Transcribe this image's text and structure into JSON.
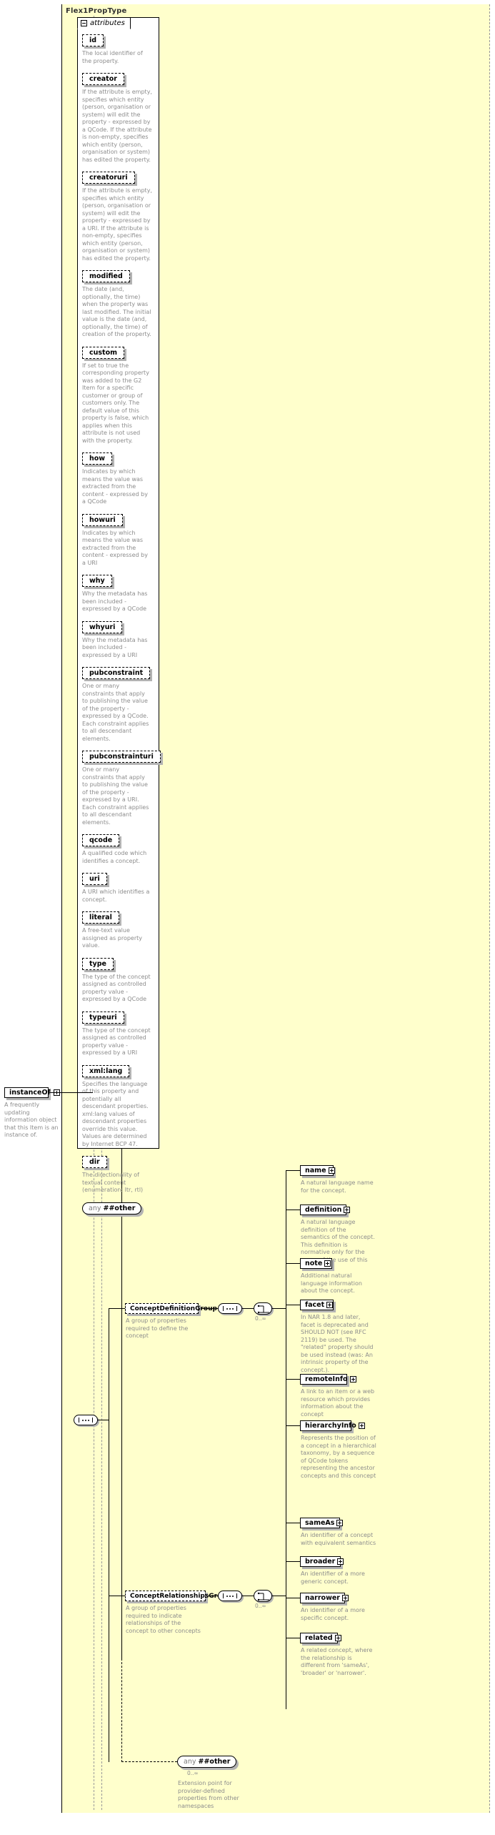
{
  "diagram": {
    "type_name": "Flex1PropType",
    "attributes_tab_label": "attributes",
    "colors": {
      "panel_fill": "#ffffcc",
      "box_fill": "#ffffff",
      "line": "#000000",
      "doc_text": "#8c8c8c",
      "shadow": "#b3b3b3"
    }
  },
  "attributes": [
    {
      "name": "id",
      "doc": "The local identifier of the property."
    },
    {
      "name": "creator",
      "doc": "If the attribute is empty, specifies which entity (person, organisation or system) will edit the property - expressed by a QCode. If the attribute is non-empty, specifies which entity (person, organisation or system) has edited the property."
    },
    {
      "name": "creatoruri",
      "doc": "If the attribute is empty, specifies which entity (person, organisation or system) will edit the property - expressed by a URI. If the attribute is non-empty, specifies which entity (person, organisation or system) has edited the property."
    },
    {
      "name": "modified",
      "doc": "The date (and, optionally, the time) when the property was last modified. The initial value is the date (and, optionally, the time) of creation of the property."
    },
    {
      "name": "custom",
      "doc": "If set to true the corresponding property was added to the G2 Item for a specific customer or group of customers only. The default value of this property is false, which applies when this attribute is not used with the property."
    },
    {
      "name": "how",
      "doc": "Indicates by which means the value was extracted from the content - expressed by a QCode"
    },
    {
      "name": "howuri",
      "doc": "Indicates by which means the value was extracted from the content - expressed by a URI"
    },
    {
      "name": "why",
      "doc": "Why the metadata has been included - expressed by a QCode"
    },
    {
      "name": "whyuri",
      "doc": "Why the metadata has been included - expressed by a URI"
    },
    {
      "name": "pubconstraint",
      "doc": "One or many constraints that apply to publishing the value of the property - expressed by a QCode. Each constraint applies to all descendant elements."
    },
    {
      "name": "pubconstrainturi",
      "doc": "One or many constraints that apply to publishing the value of the property - expressed by a URI. Each constraint applies to all descendant elements."
    },
    {
      "name": "qcode",
      "doc": "A qualified code which identifies a concept."
    },
    {
      "name": "uri",
      "doc": "A URI which identifies a concept."
    },
    {
      "name": "literal",
      "doc": "A free-text value assigned as property value."
    },
    {
      "name": "type",
      "doc": "The type of the concept assigned as controlled property value - expressed by a QCode"
    },
    {
      "name": "typeuri",
      "doc": "The type of the concept assigned as controlled property value - expressed by a URI"
    },
    {
      "name": "xml:lang",
      "doc": "Specifies the language of this property and potentially all descendant properties. xml:lang values of descendant properties override this value. Values are determined by Internet BCP 47."
    },
    {
      "name": "dir",
      "doc": "The directionality of textual content (enumeration: ltr, rtl)"
    }
  ],
  "attributes_any": {
    "prefix": "any",
    "name": "##other"
  },
  "instance_of": {
    "label": "instanceOf",
    "doc": "A frequently updating information object that this Item is an instance of."
  },
  "groups": [
    {
      "key": "concept_definition",
      "label": "ConceptDefinitionGroup",
      "doc": "A group of properties required to define the concept",
      "occurs": "0..∞",
      "children": [
        {
          "label": "name",
          "doc": "A natural language name for the concept."
        },
        {
          "label": "definition",
          "doc": "A natural language definition of the semantics of the concept. This definition is normative only for the scope of the use of this concept."
        },
        {
          "label": "note",
          "doc": "Additional natural language information about the concept."
        },
        {
          "label": "facet",
          "doc": "In NAR 1.8 and later, facet is deprecated and SHOULD NOT (see RFC 2119) be used. The \"related\" property should be used instead (was: An intrinsic property of the concept.)."
        },
        {
          "label": "remoteInfo",
          "doc": "A link to an item or a web resource which provides information about the concept"
        },
        {
          "label": "hierarchyInfo",
          "doc": "Represents the position of a concept in a hierarchical taxonomy, by a sequence of QCode tokens representing the ancestor concepts and this concept"
        }
      ]
    },
    {
      "key": "concept_relationships",
      "label": "ConceptRelationshipsGroup",
      "doc": "A group of properties required to indicate relationships of the concept to other concepts",
      "occurs": "0..∞",
      "children": [
        {
          "label": "sameAs",
          "doc": "An identifier of a concept with equivalent semantics"
        },
        {
          "label": "broader",
          "doc": "An identifier of a more generic concept."
        },
        {
          "label": "narrower",
          "doc": "An identifier of a more specific concept."
        },
        {
          "label": "related",
          "doc": "A related concept, where the relationship is different from 'sameAs', 'broader' or 'narrower'."
        }
      ]
    }
  ],
  "content_any": {
    "prefix": "any",
    "name": "##other",
    "occurs": "0..∞",
    "doc": "Extension point for provider-defined properties from other namespaces"
  }
}
